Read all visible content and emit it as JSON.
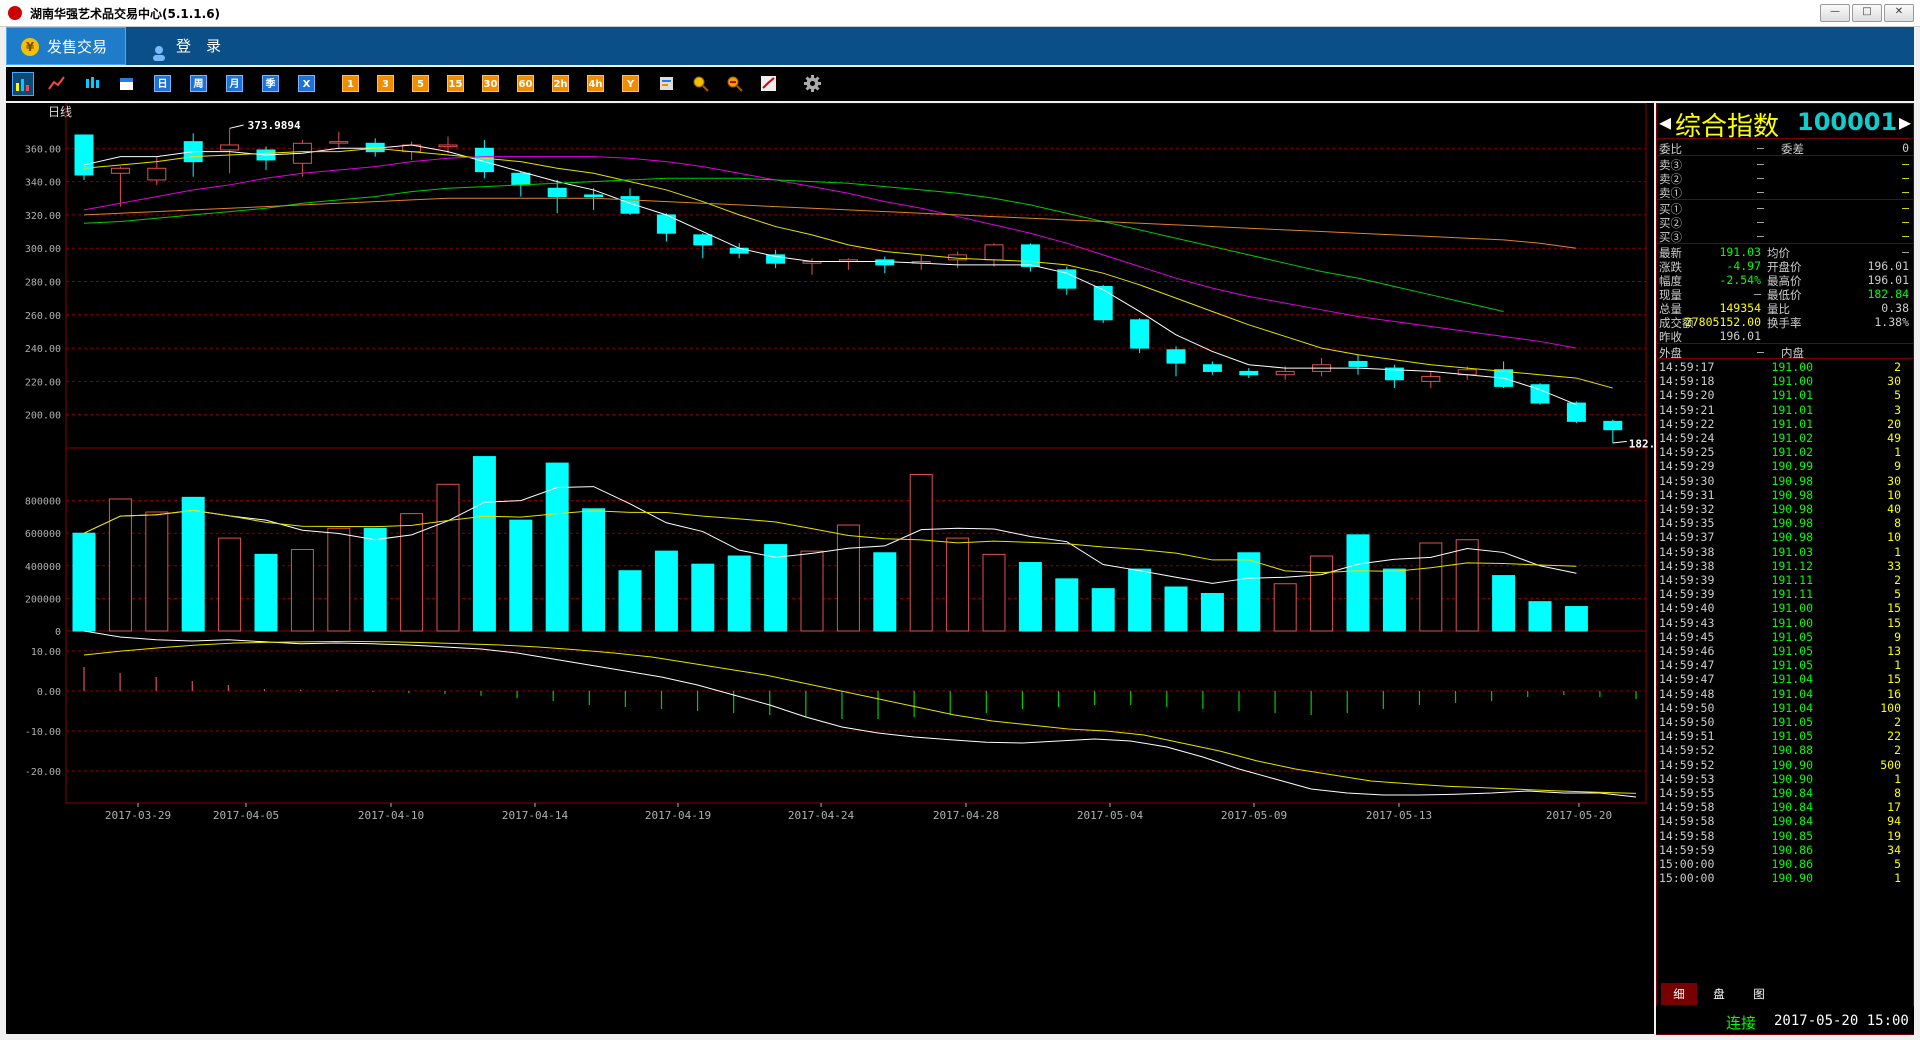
{
  "window": {
    "title": "湖南华强艺术品交易中心(5.1.1.6)",
    "controls": [
      "—",
      "□",
      "✕"
    ]
  },
  "menu": {
    "items": [
      {
        "label": "发售交易",
        "icon": "yen-icon",
        "active": true
      },
      {
        "label": "登　录",
        "icon": "user-icon",
        "active": false
      }
    ]
  },
  "toolbar": {
    "chart_tools": [
      "bar-chart-icon",
      "line-chart-icon",
      "candlestick-icon",
      "calendar-icon"
    ],
    "periods": [
      "日",
      "周",
      "月",
      "季",
      "X"
    ],
    "minutes": [
      "1",
      "3",
      "5",
      "15",
      "30",
      "60",
      "2h",
      "4h",
      "Y"
    ],
    "tools": [
      "export-icon",
      "zoom-in-icon",
      "zoom-out-icon",
      "draw-icon",
      "gear-icon"
    ]
  },
  "chart": {
    "period_label": "日线",
    "max_label": "373.9894",
    "min_label": "182.8404",
    "colors": {
      "up": "#e05050",
      "down": "#00ffff",
      "ma5": "#ffffff",
      "ma10": "#e8e000",
      "ma20": "#e000e0",
      "ma30": "#00cc00",
      "ma60": "#e08030",
      "grid": "#8b0000",
      "axis": "#b0b0b0"
    }
  },
  "chart_data": {
    "type": "candlestick",
    "price_axis": {
      "ticks": [
        "360.00",
        "340.00",
        "320.00",
        "300.00",
        "280.00",
        "260.00",
        "240.00",
        "220.00",
        "200.00"
      ],
      "ylim": [
        180,
        380
      ]
    },
    "volume_axis": {
      "ticks": [
        "800000",
        "600000",
        "400000",
        "200000",
        "0"
      ],
      "ylim": [
        0,
        1000000
      ]
    },
    "macd_axis": {
      "ticks": [
        "10.00",
        "0.00",
        "-10.00",
        "-20.00"
      ],
      "ylim": [
        -28,
        15
      ]
    },
    "date_labels": [
      "2017-03-29",
      "2017-04-05",
      "2017-04-10",
      "2017-04-14",
      "2017-04-19",
      "2017-04-24",
      "2017-04-28",
      "2017-05-04",
      "2017-05-09",
      "2017-05-13",
      "2017-05-20"
    ],
    "ohlc": [
      [
        368,
        344,
        368,
        341
      ],
      [
        345,
        348,
        349,
        325
      ],
      [
        341,
        348,
        355,
        338
      ],
      [
        364,
        352,
        369,
        343
      ],
      [
        359,
        362,
        372,
        345
      ],
      [
        359,
        353,
        361,
        347
      ],
      [
        351,
        363,
        365,
        343
      ],
      [
        364,
        364,
        370,
        360
      ],
      [
        363,
        358,
        366,
        355
      ],
      [
        358,
        362,
        364,
        353
      ],
      [
        361,
        362,
        367,
        357
      ],
      [
        360,
        346,
        365,
        342
      ],
      [
        345,
        338,
        346,
        331
      ],
      [
        336,
        331,
        341,
        321
      ],
      [
        332,
        331,
        336,
        323
      ],
      [
        331,
        321,
        336,
        320
      ],
      [
        320,
        309,
        321,
        304
      ],
      [
        308,
        302,
        309,
        294
      ],
      [
        300,
        297,
        303,
        294
      ],
      [
        296,
        291,
        299,
        288
      ],
      [
        291,
        292,
        294,
        284
      ],
      [
        292,
        293,
        294,
        287
      ],
      [
        293,
        290,
        295,
        285
      ],
      [
        291,
        292,
        296,
        287
      ],
      [
        293,
        296,
        298,
        288
      ],
      [
        293,
        302,
        303,
        289
      ],
      [
        302,
        289,
        303,
        286
      ],
      [
        287,
        276,
        289,
        272
      ],
      [
        277,
        257,
        278,
        255
      ],
      [
        257,
        240,
        258,
        237
      ],
      [
        239,
        231,
        241,
        223
      ],
      [
        230,
        226,
        232,
        224
      ],
      [
        226,
        224,
        228,
        222
      ],
      [
        224,
        226,
        229,
        221
      ],
      [
        226,
        230,
        234,
        223
      ],
      [
        232,
        229,
        236,
        224
      ],
      [
        228,
        221,
        230,
        216
      ],
      [
        220,
        223,
        226,
        216
      ],
      [
        224,
        227,
        229,
        221
      ],
      [
        227,
        217,
        232,
        216
      ],
      [
        218,
        207,
        219,
        206
      ],
      [
        207,
        196,
        208,
        195
      ],
      [
        196,
        191,
        197,
        183
      ]
    ],
    "volume": [
      600000,
      810000,
      730000,
      820000,
      570000,
      470000,
      500000,
      630000,
      630000,
      720000,
      900000,
      1070000,
      680000,
      1030000,
      750000,
      370000,
      490000,
      410000,
      460000,
      530000,
      490000,
      650000,
      480000,
      960000,
      570000,
      470000,
      420000,
      320000,
      260000,
      380000,
      270000,
      230000,
      480000,
      290000,
      460000,
      590000,
      380000,
      540000,
      560000,
      340000,
      180000,
      150000
    ],
    "series": [
      {
        "name": "MA5",
        "values": [
          350,
          355,
          355,
          358,
          358,
          356,
          357,
          360,
          360,
          362,
          358,
          352,
          346,
          340,
          335,
          327,
          320,
          310,
          300,
          295,
          292,
          292,
          292,
          291,
          290,
          290,
          290,
          285,
          275,
          262,
          248,
          238,
          230,
          228,
          228,
          228,
          227,
          226,
          224,
          222,
          215,
          206
        ]
      },
      {
        "name": "MA10",
        "values": [
          348,
          350,
          352,
          355,
          356,
          357,
          358,
          358,
          360,
          358,
          356,
          354,
          352,
          348,
          345,
          340,
          335,
          328,
          320,
          313,
          308,
          302,
          298,
          296,
          294,
          293,
          292,
          290,
          285,
          278,
          270,
          262,
          254,
          247,
          240,
          236,
          233,
          230,
          228,
          226,
          224,
          222,
          216
        ]
      },
      {
        "name": "MA20",
        "values": [
          323,
          327,
          331,
          335,
          338,
          342,
          345,
          347,
          349,
          352,
          354,
          355,
          355,
          355,
          355,
          354,
          352,
          349,
          345,
          341,
          337,
          333,
          328,
          324,
          319,
          314,
          309,
          303,
          296,
          289,
          282,
          276,
          271,
          267,
          263,
          259,
          256,
          253,
          250,
          247,
          244,
          240
        ]
      },
      {
        "name": "MA30",
        "values": [
          315,
          316,
          318,
          320,
          322,
          324,
          327,
          329,
          331,
          334,
          336,
          337,
          338,
          339,
          340,
          341,
          342,
          342,
          342,
          341,
          340,
          339,
          337,
          335,
          333,
          330,
          326,
          321,
          316,
          311,
          306,
          301,
          296,
          291,
          286,
          282,
          277,
          272,
          267,
          262
        ]
      },
      {
        "name": "MA60",
        "values": [
          320,
          321,
          322,
          323,
          324,
          325,
          326,
          327,
          328,
          329,
          330,
          330,
          330,
          330,
          330,
          329,
          328,
          327,
          326,
          325,
          324,
          323,
          322,
          321,
          320,
          319,
          318,
          317,
          316,
          315,
          314,
          313,
          312,
          311,
          310,
          309,
          308,
          307,
          306,
          305,
          303,
          300
        ]
      },
      {
        "name": "DIF",
        "values": [
          15,
          13.5,
          12.8,
          12.5,
          12.8,
          12.3,
          11.8,
          12.0,
          11.8,
          11.5,
          11.0,
          10.5,
          9.5,
          8.0,
          6.5,
          5.0,
          3.5,
          1.5,
          -1.0,
          -3.5,
          -6.5,
          -9.0,
          -10.5,
          -11.5,
          -12.2,
          -12.8,
          -13.0,
          -12.5,
          -12.0,
          -12.5,
          -14.0,
          -16.5,
          -19.5,
          -22.0,
          -24.5,
          -25.5,
          -26.0,
          -26.0,
          -25.8,
          -25.5,
          -25.0,
          -25.5,
          -25.5,
          -26.5
        ]
      },
      {
        "name": "DEA",
        "values": [
          9,
          10,
          10.8,
          11.5,
          12.0,
          12.2,
          12.3,
          12.4,
          12.3,
          12.1,
          11.8,
          11.5,
          11.0,
          10.3,
          9.5,
          8.5,
          7.0,
          5.5,
          4.0,
          2.0,
          0,
          -2.0,
          -4.0,
          -6.0,
          -7.5,
          -8.5,
          -9.5,
          -10.0,
          -11.0,
          -13.0,
          -15.0,
          -17.5,
          -19.5,
          -21.0,
          -22.5,
          -23.2,
          -23.8,
          -24.2,
          -24.6,
          -25.0,
          -25.3,
          -25.6
        ]
      },
      {
        "name": "MACD",
        "values": [
          6,
          4.5,
          3.5,
          2.5,
          1.5,
          0.5,
          0.3,
          0.2,
          -0.2,
          -0.5,
          -0.8,
          -1.2,
          -1.8,
          -2.5,
          -3.5,
          -4.0,
          -4.5,
          -5.0,
          -5.5,
          -6.0,
          -6.5,
          -7.0,
          -7.0,
          -6.5,
          -6.0,
          -5.5,
          -4.5,
          -4.0,
          -3.5,
          -3.5,
          -4.0,
          -4.5,
          -5.0,
          -5.5,
          -6.0,
          -5.5,
          -4.5,
          -3.5,
          -3.0,
          -2.5,
          -1.5,
          -1.0,
          -1.5,
          -2.0
        ]
      }
    ]
  },
  "panel": {
    "name": "综合指数",
    "code": "100001",
    "weibi_label": "委比",
    "weibi_val": "—",
    "weicha_label": "委差",
    "weicha_val": "0",
    "asks": [
      {
        "label": "卖③",
        "price": "—",
        "vol": "—"
      },
      {
        "label": "卖②",
        "price": "—",
        "vol": "—"
      },
      {
        "label": "卖①",
        "price": "—",
        "vol": "—"
      }
    ],
    "bids": [
      {
        "label": "买①",
        "price": "—",
        "vol": "—"
      },
      {
        "label": "买②",
        "price": "—",
        "vol": "—"
      },
      {
        "label": "买③",
        "price": "—",
        "vol": "—"
      }
    ],
    "quote": [
      {
        "l1": "最新",
        "v1": "191.03",
        "c1": "#00ff00",
        "l2": "均价",
        "v2": "—",
        "c2": "#ccc"
      },
      {
        "l1": "涨跌",
        "v1": "-4.97",
        "c1": "#00ff00",
        "l2": "开盘价",
        "v2": "196.01",
        "c2": "#ccc"
      },
      {
        "l1": "幅度",
        "v1": "-2.54%",
        "c1": "#00ff00",
        "l2": "最高价",
        "v2": "196.01",
        "c2": "#ccc"
      },
      {
        "l1": "现量",
        "v1": "—",
        "c1": "#ccc",
        "l2": "最低价",
        "v2": "182.84",
        "c2": "#00ff00"
      },
      {
        "l1": "总量",
        "v1": "149354",
        "c1": "#ff0",
        "l2": "量比",
        "v2": "0.38",
        "c2": "#ccc"
      },
      {
        "l1": "成交额",
        "v1": "27805152.00",
        "c1": "#ff0",
        "l2": "换手率",
        "v2": "1.38%",
        "c2": "#ccc"
      },
      {
        "l1": "昨收",
        "v1": "196.01",
        "c1": "#ccc",
        "l2": "",
        "v2": "",
        "c2": "#ccc"
      }
    ],
    "outer_label": "外盘",
    "outer_val": "—",
    "inner_label": "内盘",
    "ticks": [
      [
        "14:59:17",
        "191.00",
        "2"
      ],
      [
        "14:59:18",
        "191.00",
        "30"
      ],
      [
        "14:59:20",
        "191.01",
        "5"
      ],
      [
        "14:59:21",
        "191.01",
        "3"
      ],
      [
        "14:59:22",
        "191.01",
        "20"
      ],
      [
        "14:59:24",
        "191.02",
        "49"
      ],
      [
        "14:59:25",
        "191.02",
        "1"
      ],
      [
        "14:59:29",
        "190.99",
        "9"
      ],
      [
        "14:59:30",
        "190.98",
        "30"
      ],
      [
        "14:59:31",
        "190.98",
        "10"
      ],
      [
        "14:59:32",
        "190.98",
        "40"
      ],
      [
        "14:59:35",
        "190.98",
        "8"
      ],
      [
        "14:59:37",
        "190.98",
        "10"
      ],
      [
        "14:59:38",
        "191.03",
        "1"
      ],
      [
        "14:59:38",
        "191.12",
        "33"
      ],
      [
        "14:59:39",
        "191.11",
        "2"
      ],
      [
        "14:59:39",
        "191.11",
        "5"
      ],
      [
        "14:59:40",
        "191.00",
        "15"
      ],
      [
        "14:59:43",
        "191.00",
        "15"
      ],
      [
        "14:59:45",
        "191.05",
        "9"
      ],
      [
        "14:59:46",
        "191.05",
        "13"
      ],
      [
        "14:59:47",
        "191.05",
        "1"
      ],
      [
        "14:59:47",
        "191.04",
        "15"
      ],
      [
        "14:59:48",
        "191.04",
        "16"
      ],
      [
        "14:59:50",
        "191.04",
        "100"
      ],
      [
        "14:59:50",
        "191.05",
        "2"
      ],
      [
        "14:59:51",
        "191.05",
        "22"
      ],
      [
        "14:59:52",
        "190.88",
        "2"
      ],
      [
        "14:59:52",
        "190.90",
        "500"
      ],
      [
        "14:59:53",
        "190.90",
        "1"
      ],
      [
        "14:59:55",
        "190.84",
        "8"
      ],
      [
        "14:59:58",
        "190.84",
        "17"
      ],
      [
        "14:59:58",
        "190.84",
        "94"
      ],
      [
        "14:59:58",
        "190.85",
        "19"
      ],
      [
        "14:59:59",
        "190.86",
        "34"
      ],
      [
        "15:00:00",
        "190.86",
        "5"
      ],
      [
        "15:00:00",
        "190.90",
        "1"
      ]
    ],
    "tabs": [
      "细",
      "盘",
      "图"
    ]
  },
  "status": {
    "connection": "连接",
    "datetime": "2017-05-20 15:00"
  }
}
